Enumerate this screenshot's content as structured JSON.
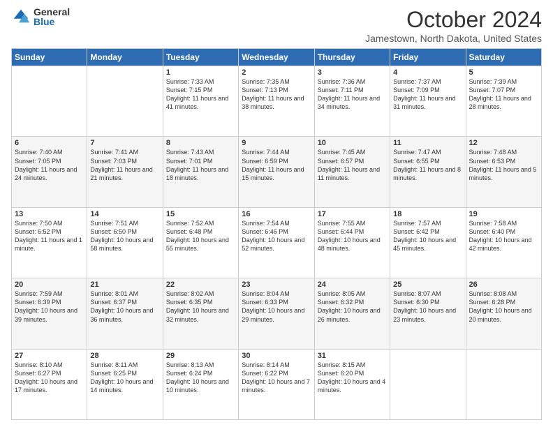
{
  "logo": {
    "general": "General",
    "blue": "Blue"
  },
  "header": {
    "month": "October 2024",
    "location": "Jamestown, North Dakota, United States"
  },
  "days_of_week": [
    "Sunday",
    "Monday",
    "Tuesday",
    "Wednesday",
    "Thursday",
    "Friday",
    "Saturday"
  ],
  "weeks": [
    [
      {
        "day": "",
        "info": ""
      },
      {
        "day": "",
        "info": ""
      },
      {
        "day": "1",
        "info": "Sunrise: 7:33 AM\nSunset: 7:15 PM\nDaylight: 11 hours and 41 minutes."
      },
      {
        "day": "2",
        "info": "Sunrise: 7:35 AM\nSunset: 7:13 PM\nDaylight: 11 hours and 38 minutes."
      },
      {
        "day": "3",
        "info": "Sunrise: 7:36 AM\nSunset: 7:11 PM\nDaylight: 11 hours and 34 minutes."
      },
      {
        "day": "4",
        "info": "Sunrise: 7:37 AM\nSunset: 7:09 PM\nDaylight: 11 hours and 31 minutes."
      },
      {
        "day": "5",
        "info": "Sunrise: 7:39 AM\nSunset: 7:07 PM\nDaylight: 11 hours and 28 minutes."
      }
    ],
    [
      {
        "day": "6",
        "info": "Sunrise: 7:40 AM\nSunset: 7:05 PM\nDaylight: 11 hours and 24 minutes."
      },
      {
        "day": "7",
        "info": "Sunrise: 7:41 AM\nSunset: 7:03 PM\nDaylight: 11 hours and 21 minutes."
      },
      {
        "day": "8",
        "info": "Sunrise: 7:43 AM\nSunset: 7:01 PM\nDaylight: 11 hours and 18 minutes."
      },
      {
        "day": "9",
        "info": "Sunrise: 7:44 AM\nSunset: 6:59 PM\nDaylight: 11 hours and 15 minutes."
      },
      {
        "day": "10",
        "info": "Sunrise: 7:45 AM\nSunset: 6:57 PM\nDaylight: 11 hours and 11 minutes."
      },
      {
        "day": "11",
        "info": "Sunrise: 7:47 AM\nSunset: 6:55 PM\nDaylight: 11 hours and 8 minutes."
      },
      {
        "day": "12",
        "info": "Sunrise: 7:48 AM\nSunset: 6:53 PM\nDaylight: 11 hours and 5 minutes."
      }
    ],
    [
      {
        "day": "13",
        "info": "Sunrise: 7:50 AM\nSunset: 6:52 PM\nDaylight: 11 hours and 1 minute."
      },
      {
        "day": "14",
        "info": "Sunrise: 7:51 AM\nSunset: 6:50 PM\nDaylight: 10 hours and 58 minutes."
      },
      {
        "day": "15",
        "info": "Sunrise: 7:52 AM\nSunset: 6:48 PM\nDaylight: 10 hours and 55 minutes."
      },
      {
        "day": "16",
        "info": "Sunrise: 7:54 AM\nSunset: 6:46 PM\nDaylight: 10 hours and 52 minutes."
      },
      {
        "day": "17",
        "info": "Sunrise: 7:55 AM\nSunset: 6:44 PM\nDaylight: 10 hours and 48 minutes."
      },
      {
        "day": "18",
        "info": "Sunrise: 7:57 AM\nSunset: 6:42 PM\nDaylight: 10 hours and 45 minutes."
      },
      {
        "day": "19",
        "info": "Sunrise: 7:58 AM\nSunset: 6:40 PM\nDaylight: 10 hours and 42 minutes."
      }
    ],
    [
      {
        "day": "20",
        "info": "Sunrise: 7:59 AM\nSunset: 6:39 PM\nDaylight: 10 hours and 39 minutes."
      },
      {
        "day": "21",
        "info": "Sunrise: 8:01 AM\nSunset: 6:37 PM\nDaylight: 10 hours and 36 minutes."
      },
      {
        "day": "22",
        "info": "Sunrise: 8:02 AM\nSunset: 6:35 PM\nDaylight: 10 hours and 32 minutes."
      },
      {
        "day": "23",
        "info": "Sunrise: 8:04 AM\nSunset: 6:33 PM\nDaylight: 10 hours and 29 minutes."
      },
      {
        "day": "24",
        "info": "Sunrise: 8:05 AM\nSunset: 6:32 PM\nDaylight: 10 hours and 26 minutes."
      },
      {
        "day": "25",
        "info": "Sunrise: 8:07 AM\nSunset: 6:30 PM\nDaylight: 10 hours and 23 minutes."
      },
      {
        "day": "26",
        "info": "Sunrise: 8:08 AM\nSunset: 6:28 PM\nDaylight: 10 hours and 20 minutes."
      }
    ],
    [
      {
        "day": "27",
        "info": "Sunrise: 8:10 AM\nSunset: 6:27 PM\nDaylight: 10 hours and 17 minutes."
      },
      {
        "day": "28",
        "info": "Sunrise: 8:11 AM\nSunset: 6:25 PM\nDaylight: 10 hours and 14 minutes."
      },
      {
        "day": "29",
        "info": "Sunrise: 8:13 AM\nSunset: 6:24 PM\nDaylight: 10 hours and 10 minutes."
      },
      {
        "day": "30",
        "info": "Sunrise: 8:14 AM\nSunset: 6:22 PM\nDaylight: 10 hours and 7 minutes."
      },
      {
        "day": "31",
        "info": "Sunrise: 8:15 AM\nSunset: 6:20 PM\nDaylight: 10 hours and 4 minutes."
      },
      {
        "day": "",
        "info": ""
      },
      {
        "day": "",
        "info": ""
      }
    ]
  ]
}
